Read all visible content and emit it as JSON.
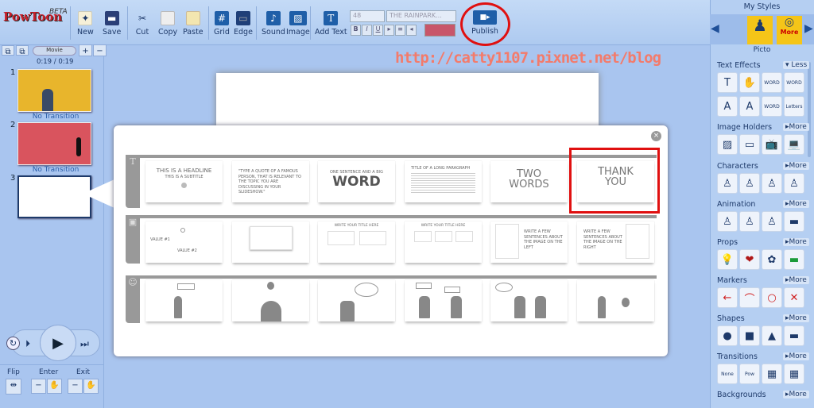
{
  "toolbar": {
    "logo": "PowToon",
    "beta": "BETA",
    "new": "New",
    "save": "Save",
    "cut": "Cut",
    "copy": "Copy",
    "paste": "Paste",
    "grid": "Grid",
    "edge": "Edge",
    "sound": "Sound",
    "image": "Image",
    "add_text": "Add Text",
    "font_size": "48",
    "font_name": "THE RAINPARK...",
    "bold": "B",
    "italic": "I",
    "underline": "U",
    "publish": "Publish",
    "color_swatch": "#c8566a"
  },
  "watermark": "http://catty1107.pixnet.net/blog",
  "left": {
    "mode": "Movie",
    "time": "0:19 / 0:19",
    "slides": [
      {
        "num": "1",
        "transition": "No Transition",
        "bg": "#e8b52c"
      },
      {
        "num": "2",
        "transition": "No Transition",
        "bg": "#d9545e"
      },
      {
        "num": "3"
      }
    ],
    "flip": "Flip",
    "enter": "Enter",
    "exit": "Exit"
  },
  "dialog": {
    "close": "×",
    "rows": [
      {
        "icon": "T",
        "cards": [
          {
            "t1": "THIS IS A HEADLINE",
            "t2": "THIS IS A SUBTITLE"
          },
          {
            "t1": "\"TYPE A QUOTE OF A FAMOUS PERSON, THAT IS RELEVANT TO THE TOPIC YOU ARE DISCUSSING IN YOUR SLIDESHOW.\""
          },
          {
            "t1": "ONE SENTENCE AND A BIG",
            "t2": "WORD"
          },
          {
            "t1": "TITLE OF A LONG PARAGRAPH"
          },
          {
            "t2": "TWO WORDS"
          },
          {
            "t2": "THANK YOU"
          }
        ]
      },
      {
        "icon": "▣",
        "cards": [
          {
            "t1": "VALUE #1",
            "t2": "VALUE #2"
          },
          {
            "t1": ""
          },
          {
            "t1": "WRITE YOUR TITLE HERE"
          },
          {
            "t1": "WRITE YOUR TITLE HERE"
          },
          {
            "t1": "WRITE A FEW SENTENCES ABOUT THE IMAGE ON THE LEFT"
          },
          {
            "t1": "WRITE A FEW SENTENCES ABOUT THE IMAGE ON THE RIGHT"
          }
        ]
      },
      {
        "icon": "☺"
      }
    ]
  },
  "right": {
    "title": "My Styles",
    "style": "Picto",
    "more_badge": "More",
    "sections": [
      {
        "name": "Text Effects",
        "toggle": "▾ Less"
      },
      {
        "name": "Image Holders",
        "toggle": "▸More"
      },
      {
        "name": "Characters",
        "toggle": "▸More"
      },
      {
        "name": "Animation",
        "toggle": "▸More"
      },
      {
        "name": "Props",
        "toggle": "▸More"
      },
      {
        "name": "Markers",
        "toggle": "▸More"
      },
      {
        "name": "Shapes",
        "toggle": "▸More"
      },
      {
        "name": "Transitions",
        "toggle": "▸More"
      },
      {
        "name": "Backgrounds",
        "toggle": "▸More"
      }
    ],
    "tiles": {
      "text_effects": [
        "T",
        "✋",
        "WORD",
        "WORD",
        "A",
        "A",
        "WORD",
        "Letters"
      ],
      "transition_none": "None"
    }
  }
}
